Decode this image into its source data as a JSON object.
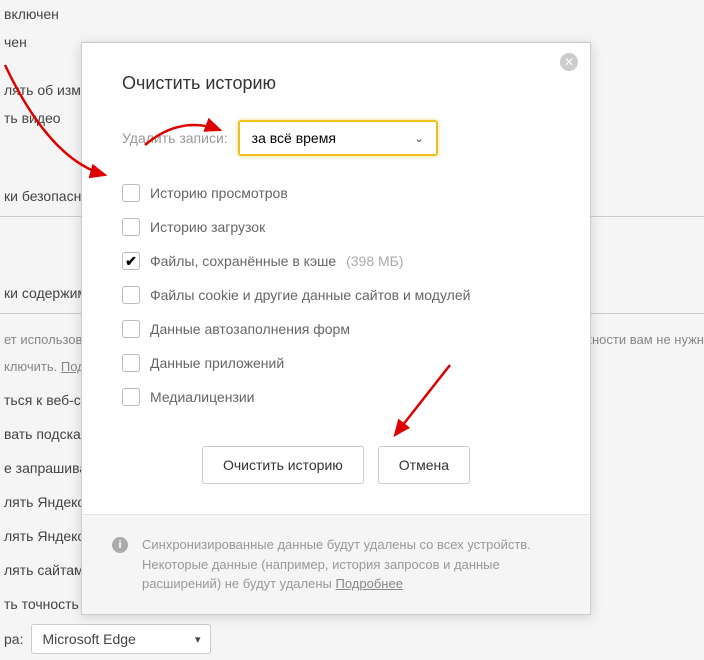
{
  "background": {
    "lines": [
      "включен",
      "чен",
      "лять об изме",
      "ть видео",
      "ки безопасн",
      "ки содержим"
    ],
    "cookie_note_pre": "ет использова",
    "cookie_note_post": "жности вам не нужн",
    "cookie_note_2": "ключить. ",
    "cookie_note_link": "Под",
    "other_lines": [
      "ться к веб-с",
      "вать подска",
      "е запрашива",
      "лять Яндексу",
      "лять Яндексу",
      "лять сайтам"
    ],
    "zen_line": "ть точность рекомендаций Дзена и качество рекламы с помощью данных из",
    "browser_label": "ра:",
    "browser_value": "Microsoft Edge"
  },
  "modal": {
    "title": "Очистить историю",
    "time_label": "Удалить записи:",
    "time_value": "за всё время",
    "checks": [
      {
        "label": "Историю просмотров",
        "checked": false
      },
      {
        "label": "Историю загрузок",
        "checked": false
      },
      {
        "label": "Файлы, сохранённые в кэше",
        "checked": true,
        "size": "(398 МБ)"
      },
      {
        "label": "Файлы cookie и другие данные сайтов и модулей",
        "checked": false
      },
      {
        "label": "Данные автозаполнения форм",
        "checked": false
      },
      {
        "label": "Данные приложений",
        "checked": false
      },
      {
        "label": "Медиалицензии",
        "checked": false
      }
    ],
    "confirm_button": "Очистить историю",
    "cancel_button": "Отмена",
    "footer_text_1": "Синхронизированные данные будут удалены со всех устройств. Некоторые данные (например, история запросов и данные расширений) не будут удалены ",
    "footer_link": "Подробнее"
  }
}
